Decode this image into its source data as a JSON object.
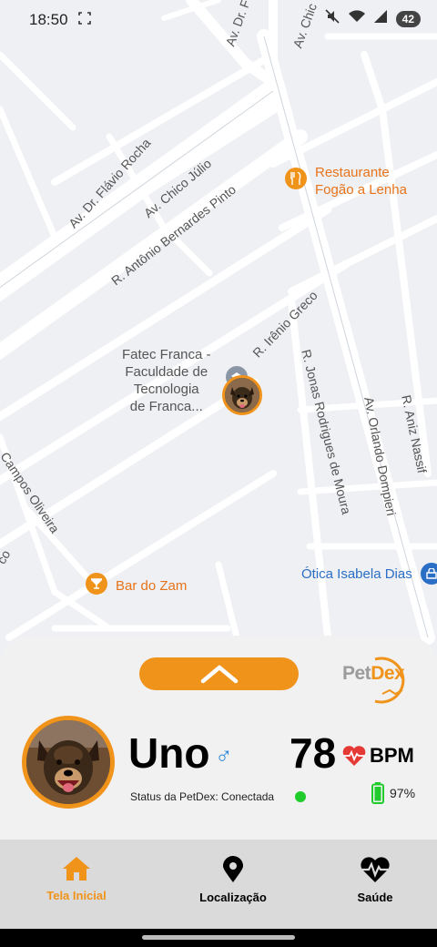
{
  "status_bar": {
    "time": "18:50",
    "battery": "42"
  },
  "map": {
    "streets": [
      "Av. Dr. Flávio Rocha",
      "Av. Chico Júlio",
      "R. Antônio Bernardes Pinto",
      "R. Irênio Greco",
      "R. Jonas Rodrigues de Moura",
      "Av. Orlando Dompieri",
      "R. Aniz Nassif",
      "Campos Oliveira",
      "co",
      "Av. Dr. F",
      "Av. Chic"
    ],
    "pois": {
      "restaurant": [
        "Restaurante",
        "Fogão a Lenha"
      ],
      "fatec": [
        "Fatec Franca -",
        "Faculdade de",
        "Tecnologia",
        "de Franca..."
      ],
      "bar": "Bar do Zam",
      "optica": "Ótica Isabela Dias"
    }
  },
  "panel": {
    "logo_pet": "Pet",
    "logo_dex": "Dex",
    "pet_name": "Uno",
    "gender_symbol": "♂",
    "bpm_value": "78",
    "bpm_label": "BPM",
    "status_text": "Status da PetDex: Conectada",
    "battery_percent": "97%"
  },
  "navbar": {
    "items": [
      {
        "label": "Tela Inicial",
        "icon": "home-icon",
        "active": true
      },
      {
        "label": "Localização",
        "icon": "location-pin-icon",
        "active": false
      },
      {
        "label": "Saúde",
        "icon": "heart-pulse-icon",
        "active": false
      }
    ]
  },
  "colors": {
    "accent": "#f0931a",
    "connected": "#1fcc2c",
    "male": "#2a86d9",
    "heart": "#e53935"
  }
}
